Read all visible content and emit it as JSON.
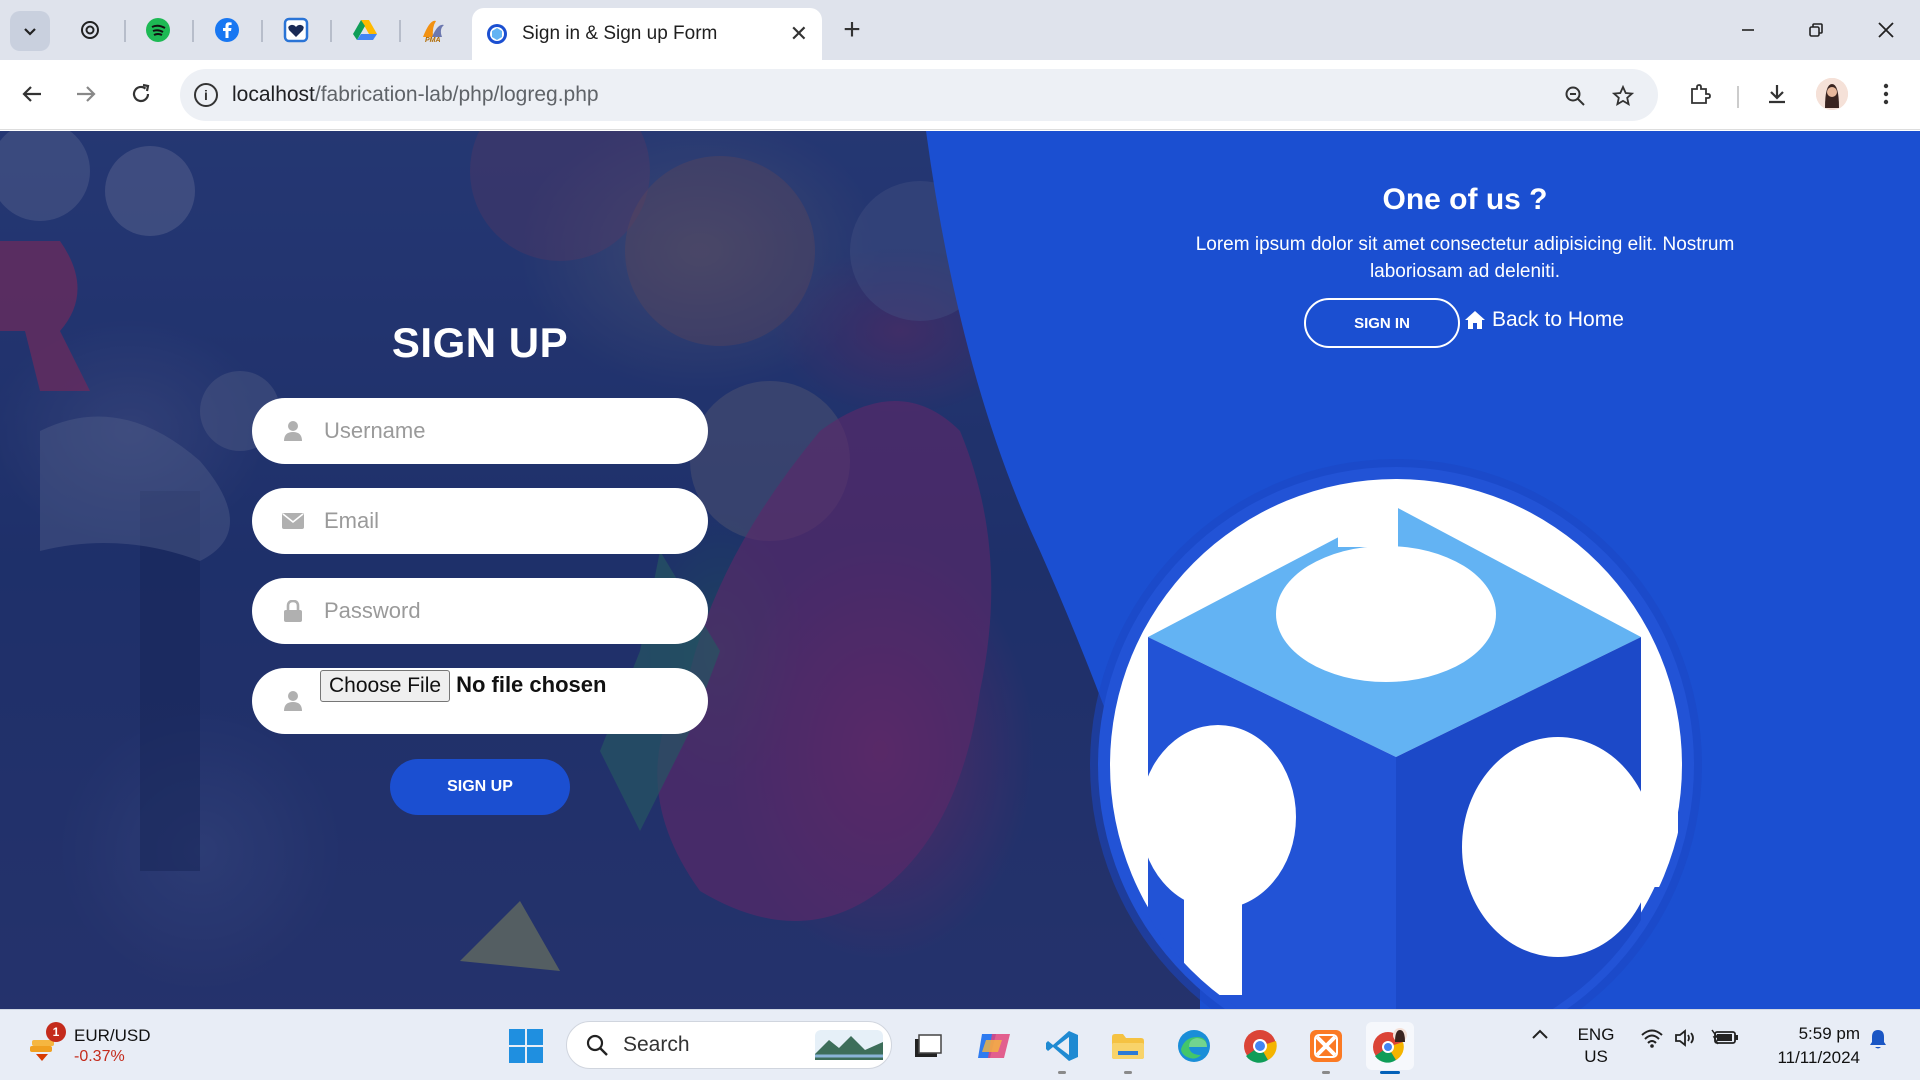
{
  "browser": {
    "active_tab_title": "Sign in & Sign up Form",
    "url_host": "localhost",
    "url_path": "/fabrication-lab/php/logreg.php",
    "pinned_tabs": [
      "openai-icon",
      "spotify-icon",
      "facebook-icon",
      "heart-shield-icon",
      "google-drive-icon",
      "phpmyadmin-icon"
    ]
  },
  "form": {
    "title": "SIGN UP",
    "username_placeholder": "Username",
    "email_placeholder": "Email",
    "password_placeholder": "Password",
    "file_button": "Choose File",
    "file_status": "No file chosen",
    "submit_label": "SIGN UP"
  },
  "panel": {
    "title": "One of us ?",
    "text": "Lorem ipsum dolor sit amet consectetur adipisicing elit. Nostrum laboriosam ad deleniti.",
    "signin_label": "SIGN IN",
    "home_link": "Back to Home"
  },
  "taskbar": {
    "ticker_pair": "EUR/USD",
    "ticker_change": "-0.37%",
    "notification_count": "1",
    "search_label": "Search",
    "lang_line1": "ENG",
    "lang_line2": "US",
    "time": "5:59 pm",
    "date": "11/11/2024"
  },
  "colors": {
    "brand_blue": "#1b4fd1",
    "logo_light_blue": "#63b3f3",
    "logo_dark_blue": "#2253d6"
  }
}
